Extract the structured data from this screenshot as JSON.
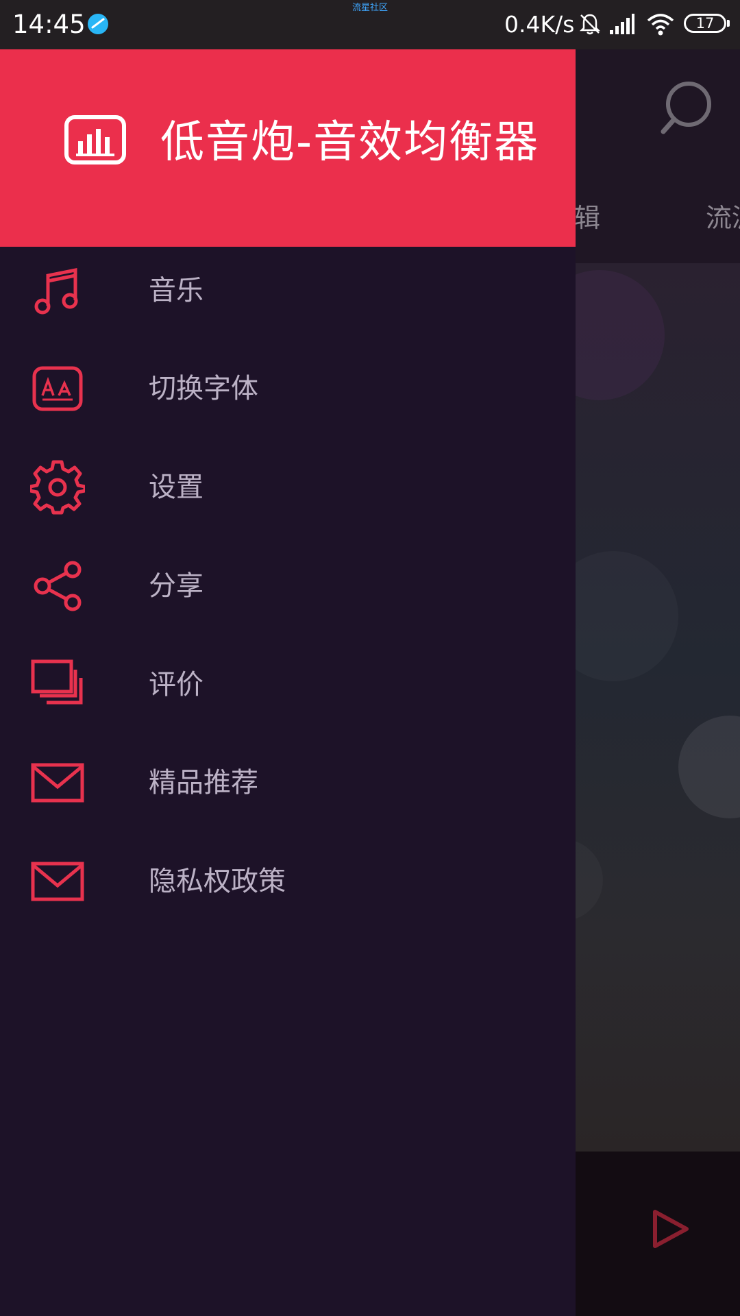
{
  "status_bar": {
    "time": "14:45",
    "carrier_text": "流星社区",
    "network_speed": "0.4K/s",
    "battery": "17",
    "icons": [
      "app-notification-icon",
      "mute-bell-icon",
      "signal-icon",
      "wifi-icon",
      "battery-icon"
    ]
  },
  "background": {
    "tabs": [
      "专辑",
      "流派"
    ],
    "icons": [
      "search-icon",
      "play-icon"
    ]
  },
  "drawer": {
    "app_title": "低音炮-音效均衡器",
    "logo_icon": "equalizer-icon",
    "menu": [
      {
        "label": "音乐",
        "icon": "music-note-icon"
      },
      {
        "label": "切换字体",
        "icon": "font-icon"
      },
      {
        "label": "设置",
        "icon": "gear-icon"
      },
      {
        "label": "分享",
        "icon": "share-icon"
      },
      {
        "label": "评价",
        "icon": "stack-icon"
      },
      {
        "label": "精品推荐",
        "icon": "mail-icon"
      },
      {
        "label": "隐私权政策",
        "icon": "mail-icon"
      }
    ]
  },
  "colors": {
    "accent": "#eb2f4c",
    "drawer_bg": "#1d1228",
    "menu_text": "#bcb2c6",
    "status_bar_bg": "#231f22"
  }
}
